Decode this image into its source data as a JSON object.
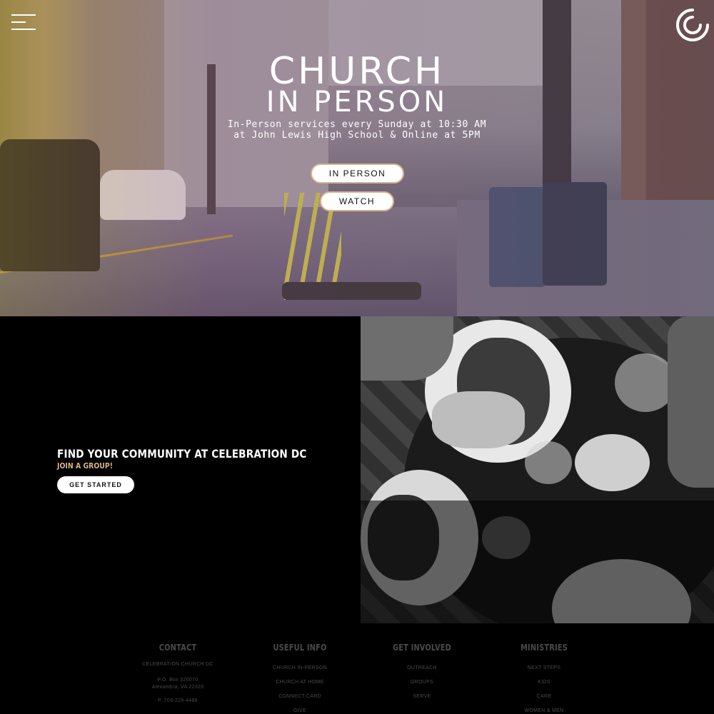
{
  "hero": {
    "title_line1": "CHURCH",
    "title_line2": "IN PERSON",
    "subtitle_line1": "In-Person services every Sunday at 10:30 AM",
    "subtitle_line2": "at John Lewis High School & Online at 5PM",
    "buttons": {
      "in_person": "IN PERSON",
      "watch": "WATCH"
    }
  },
  "header": {
    "menu_icon": "hamburger-menu-icon",
    "logo_icon": "celebration-logo-icon"
  },
  "community": {
    "title": "FIND YOUR COMMUNITY AT CELEBRATION DC",
    "subtitle": "JOIN A GROUP!",
    "button": "GET STARTED"
  },
  "footer": {
    "contact": {
      "heading": "CONTACT",
      "org": "CELEBRATION CHURCH DC",
      "address_line1": "P.O. Box 320070",
      "address_line2": "Alexandria, VA 22320",
      "phone": "P. 703-229-4488"
    },
    "useful_info": {
      "heading": "USEFUL INFO",
      "links": [
        "CHURCH IN-PERSON",
        "CHURCH AT HOME",
        "CONNECT CARD",
        "GIVE"
      ]
    },
    "get_involved": {
      "heading": "GET INVOLVED",
      "links": [
        "OUTREACH",
        "GROUPS",
        "SERVE"
      ]
    },
    "ministries": {
      "heading": "MINISTRIES",
      "links": [
        "NEXT STEPS",
        "KIDS",
        "CARE",
        "WOMEN & MEN"
      ]
    }
  },
  "colors": {
    "accent_tan": "#d9b28a",
    "background": "#000000",
    "footer_text": "#4a4a4a"
  }
}
